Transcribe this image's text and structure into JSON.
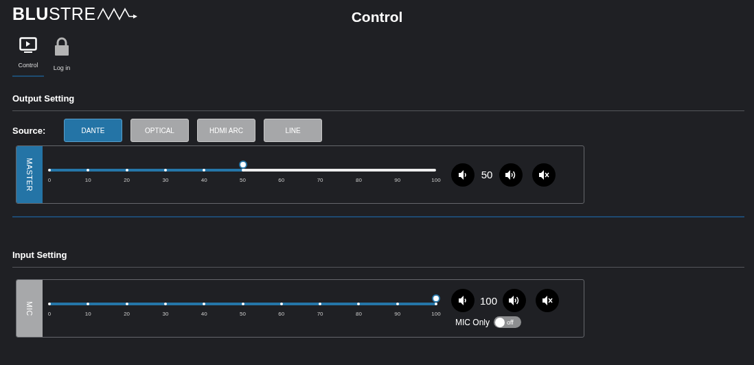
{
  "header": {
    "logo": "**BLU**STRE",
    "title": "Control"
  },
  "nav_tabs": [
    {
      "label": "Control",
      "selected": true,
      "kind": "screen"
    },
    {
      "label": "Log in",
      "selected": false,
      "kind": "lock"
    }
  ],
  "output_setting": {
    "heading": "Output Setting",
    "source_label": "Source:",
    "sources": [
      {
        "label": "DANTE",
        "selected": true
      },
      {
        "label": "OPTICAL",
        "selected": false
      },
      {
        "label": "HDMI ARC",
        "selected": false
      },
      {
        "label": "LINE",
        "selected": false
      }
    ],
    "channel": {
      "name": "MASTER",
      "selected": true,
      "level": 0.5,
      "ticks": [
        "0",
        "10",
        "20",
        "30",
        "40",
        "50",
        "60",
        "70",
        "80",
        "90",
        "100"
      ],
      "value": "50"
    }
  },
  "input_setting": {
    "heading": "Input Setting",
    "channel": {
      "name": "MIC",
      "selected": false,
      "level": 1,
      "ticks": [
        "0",
        "10",
        "20",
        "30",
        "40",
        "50",
        "60",
        "70",
        "80",
        "90",
        "100"
      ],
      "value": "100",
      "mic_only": {
        "label": "MIC Only",
        "on": false,
        "state_text": "off"
      }
    }
  }
}
